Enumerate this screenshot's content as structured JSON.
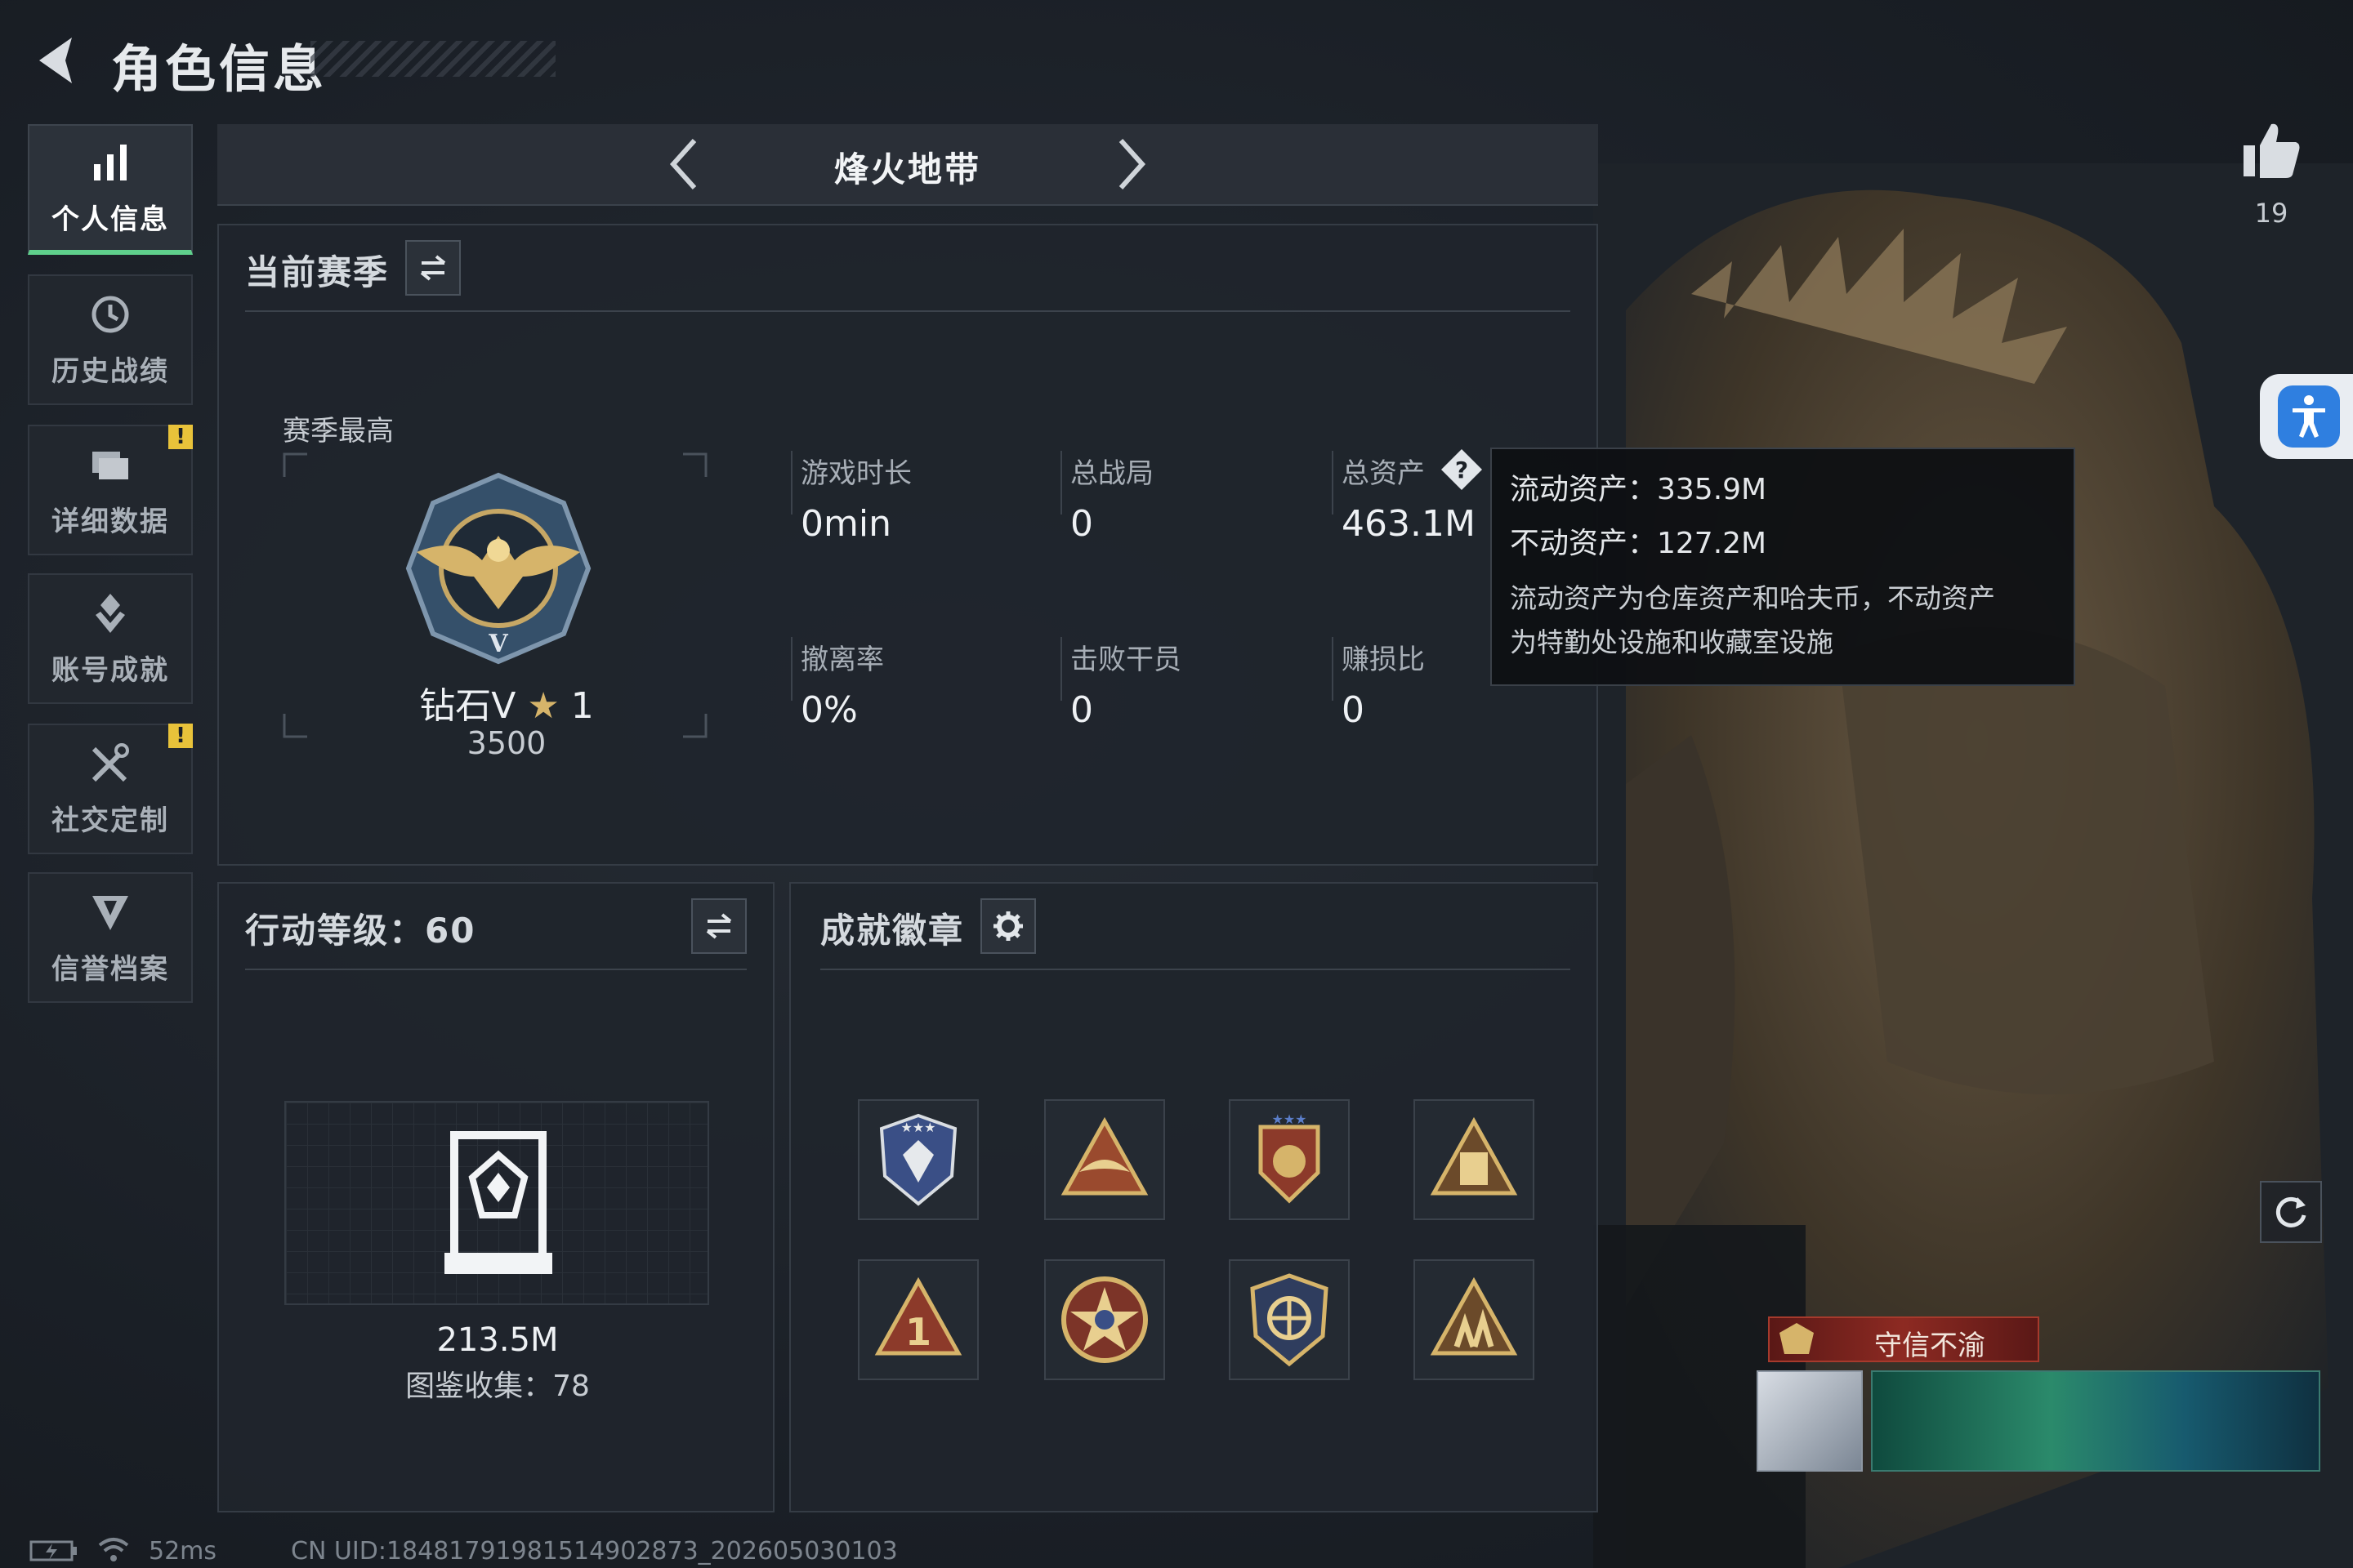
{
  "header": {
    "title": "角色信息"
  },
  "sidebar": {
    "items": [
      {
        "label": "个人信息",
        "icon": "bar-chart-icon",
        "active": true,
        "alert": ""
      },
      {
        "label": "历史战绩",
        "icon": "history-clock-icon",
        "active": false,
        "alert": ""
      },
      {
        "label": "详细数据",
        "icon": "folder-icon",
        "active": false,
        "alert": "!"
      },
      {
        "label": "账号成就",
        "icon": "achievement-icon",
        "active": false,
        "alert": ""
      },
      {
        "label": "社交定制",
        "icon": "tools-icon",
        "active": false,
        "alert": "!"
      },
      {
        "label": "信誉档案",
        "icon": "reputation-shield-icon",
        "active": false,
        "alert": ""
      }
    ]
  },
  "mode_selector": {
    "title": "烽火地带"
  },
  "likes": {
    "count": "19"
  },
  "season": {
    "title": "当前赛季",
    "best_label": "赛季最高",
    "rank_name": "钻石V",
    "rank_stars": "1",
    "rank_points": "3500",
    "stats": [
      {
        "label": "游戏时长",
        "value": "0min"
      },
      {
        "label": "总战局",
        "value": "0"
      },
      {
        "label": "总资产",
        "value": "463.1M"
      },
      {
        "label": "撤离率",
        "value": "0%"
      },
      {
        "label": "击败干员",
        "value": "0"
      },
      {
        "label": "赚损比",
        "value": "0"
      }
    ]
  },
  "tooltip": {
    "liquid": "流动资产：335.9M",
    "fixed": "不动资产：127.2M",
    "desc_line1": "流动资产为仓库资产和哈夫币，不动资产",
    "desc_line2": "为特勤处设施和收藏室设施"
  },
  "action_level": {
    "title": "行动等级：60",
    "value": "213.5M",
    "collection": "图鉴收集：78"
  },
  "achievements": {
    "title": "成就徽章",
    "badges": [
      {
        "icon": "shield-star-badge-icon"
      },
      {
        "icon": "triangle-wings-badge-icon"
      },
      {
        "icon": "crest-stars-badge-icon"
      },
      {
        "icon": "triangle-tower-badge-icon"
      },
      {
        "icon": "triangle-number-one-badge-icon"
      },
      {
        "icon": "star-circle-badge-icon"
      },
      {
        "icon": "shield-target-badge-icon"
      },
      {
        "icon": "triangle-soldiers-badge-icon"
      }
    ]
  },
  "character": {
    "title_tag": "守信不渝"
  },
  "status_bar": {
    "ping": "52ms",
    "uid": "CN UID:18481791981514902873_202605030103"
  },
  "colors": {
    "accent": "#5fd08c",
    "alert": "#e8c23a",
    "accessibility": "#2f7fe0"
  }
}
